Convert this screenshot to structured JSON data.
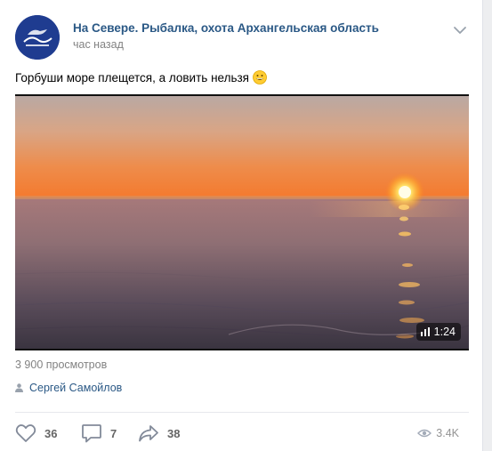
{
  "post": {
    "group_name": "На Севере. Рыбалка, охота Архангельская область",
    "time": "час назад",
    "text": "Горбуши море плещется, а ловить нельзя",
    "emoji_icon": "grinning-face-emoji"
  },
  "video": {
    "duration": "1:24",
    "views": "3 900 просмотров",
    "author": "Сергей Самойлов"
  },
  "actions": {
    "likes": "36",
    "comments": "7",
    "shares": "38",
    "views": "3.4K"
  },
  "colors": {
    "link": "#2a5885",
    "muted": "#828282",
    "icon": "#828a99"
  }
}
